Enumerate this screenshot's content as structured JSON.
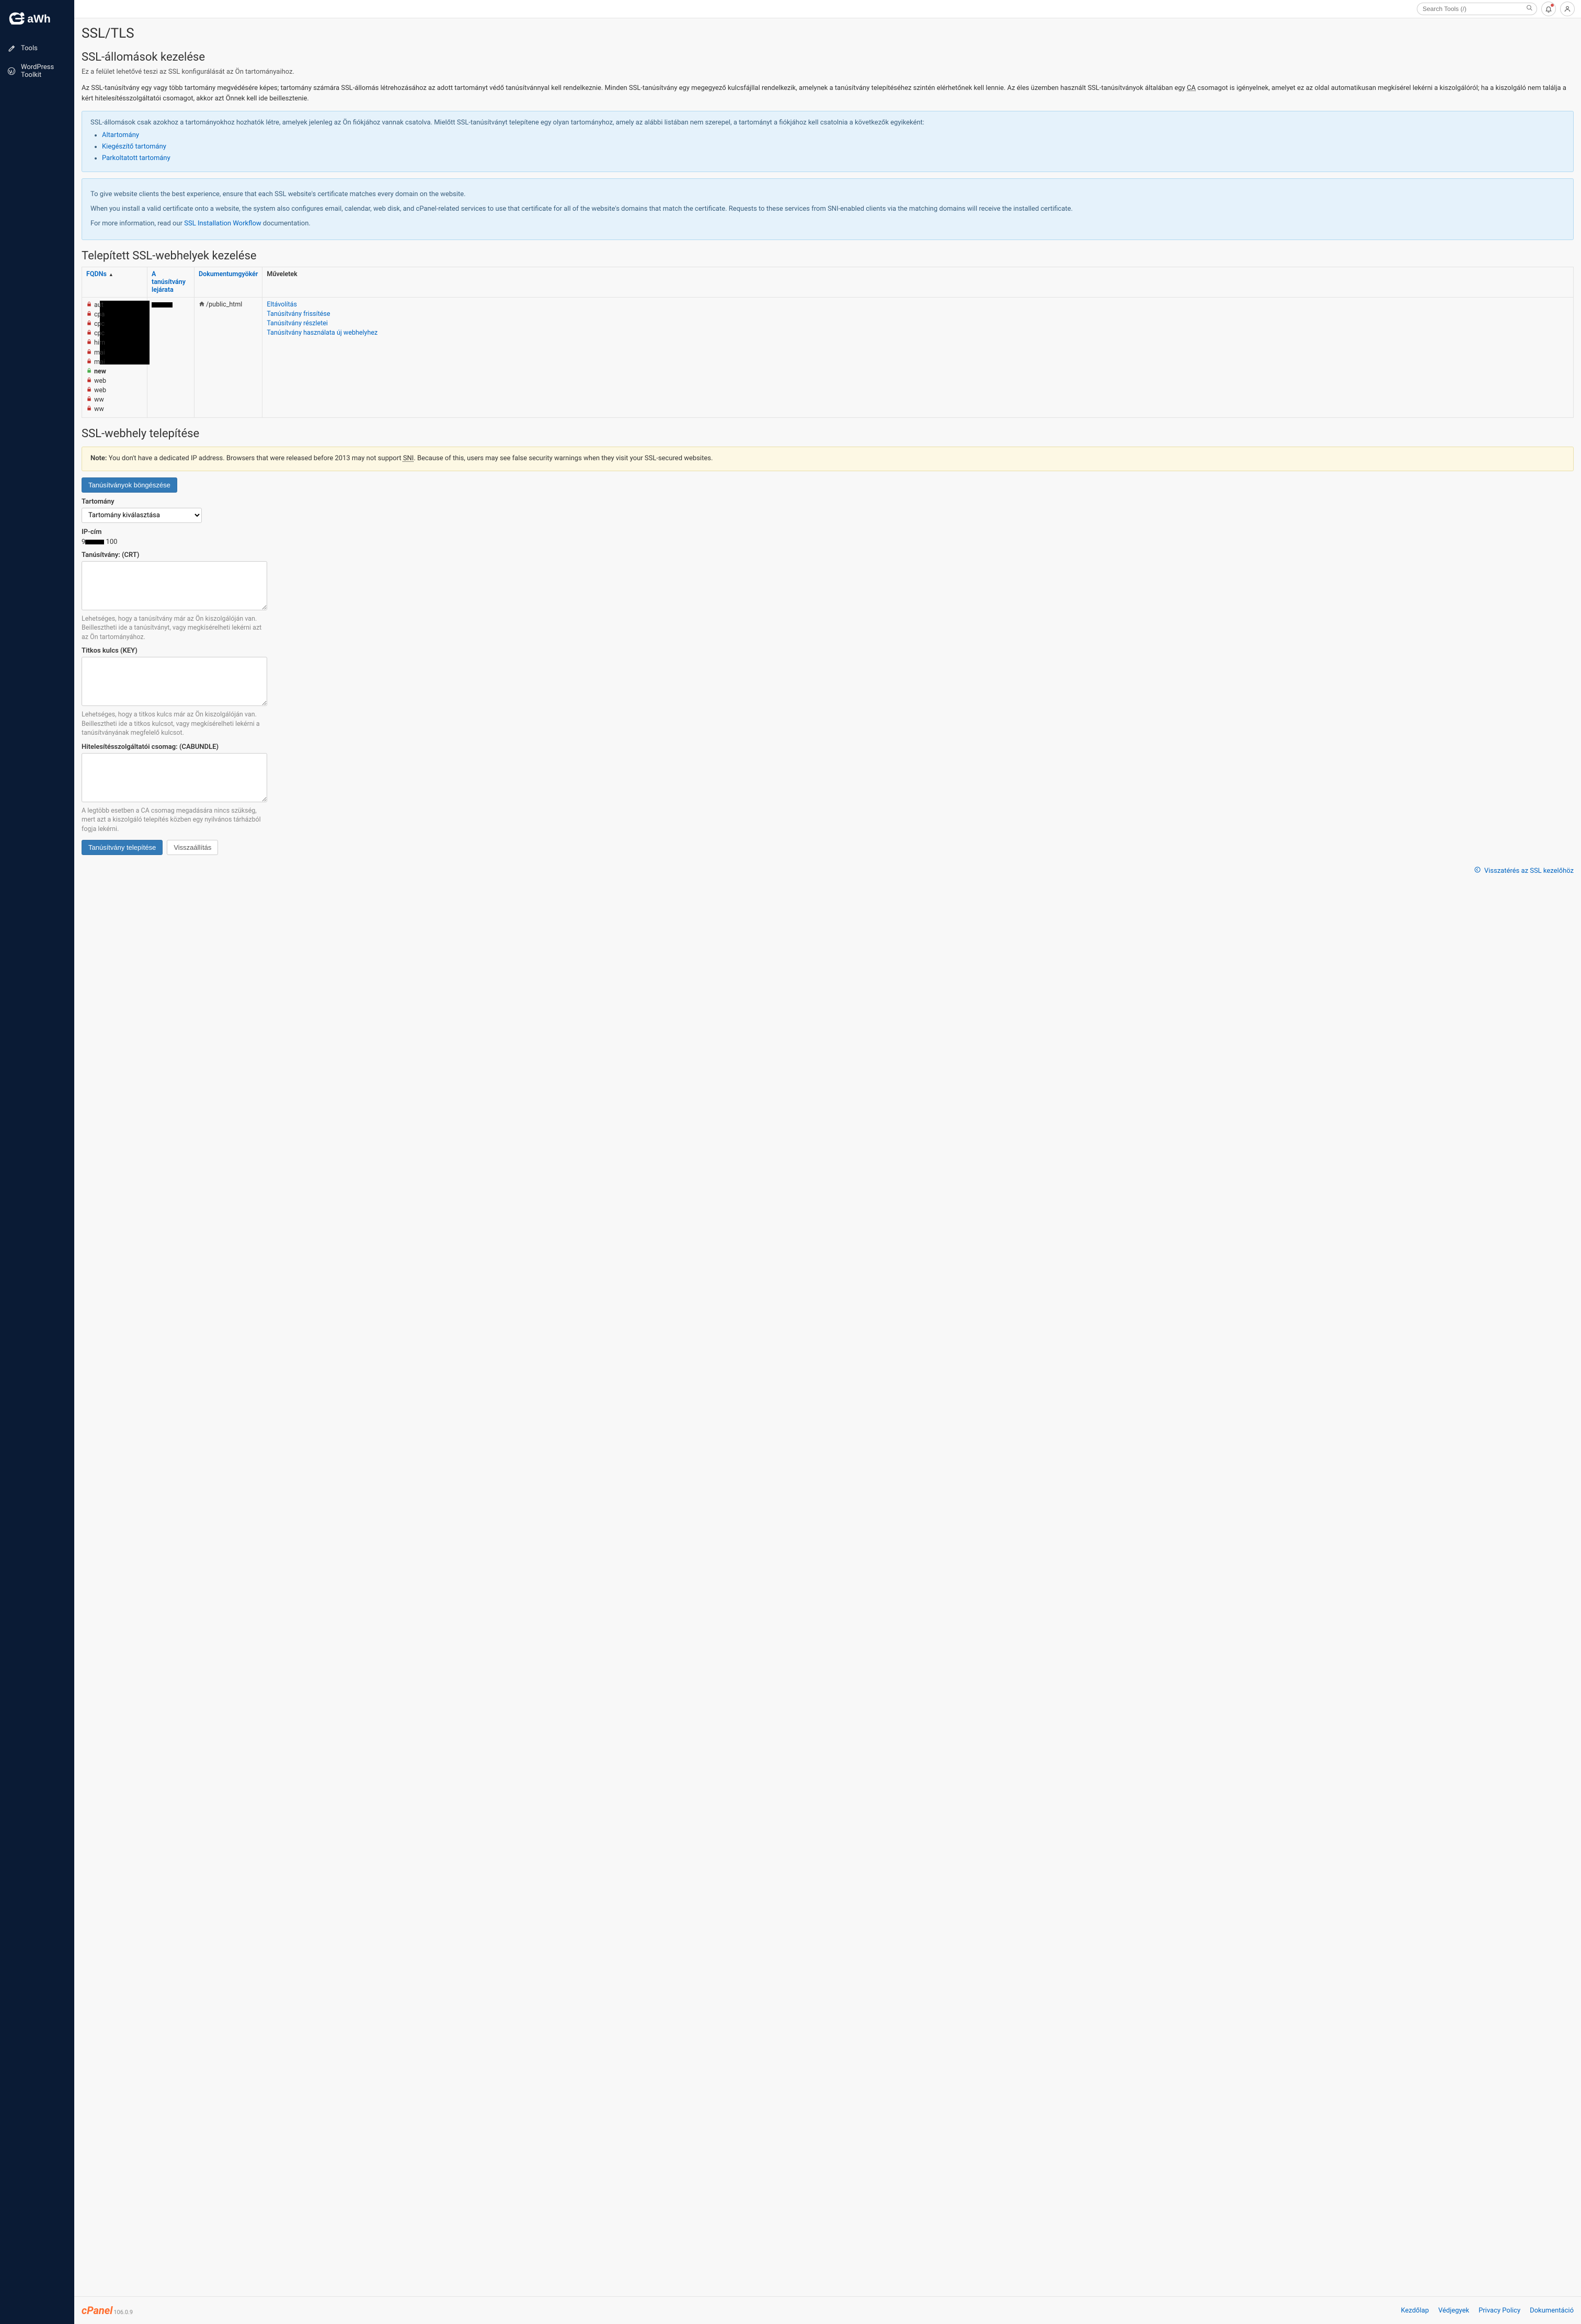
{
  "search": {
    "placeholder": "Search Tools (/)"
  },
  "sidebar": {
    "items": [
      {
        "label": "Tools"
      },
      {
        "label": "WordPress Toolkit"
      }
    ]
  },
  "page": {
    "title": "SSL/TLS",
    "h2_manage": "SSL-állomások kezelése",
    "desc": "Ez a felület lehetővé teszi az SSL konfigurálását az Ön tartományaihoz.",
    "para1_a": "Az SSL-tanúsítvány egy vagy több tartomány megvédésére képes; tartomány számára SSL-állomás létrehozásához az adott tartományt védő tanúsítvánnyal kell rendelkeznie. Minden SSL-tanúsítvány egy megegyező kulcsfájllal rendelkezik, amelynek a tanúsítvány telepítéséhez szintén elérhetőnek kell lennie. Az éles üzemben használt SSL-tanúsítványok általában egy ",
    "para1_abbr": "CA",
    "para1_b": " csomagot is igényelnek, amelyet ez az oldal automatikusan megkísérel lekérni a kiszolgálóról; ha a kiszolgáló nem találja a kért hitelesítésszolgáltatói csomagot, akkor azt Önnek kell ide beillesztenie.",
    "alert1_intro": "SSL-állomások csak azokhoz a tartományokhoz hozhatók létre, amelyek jelenleg az Ön fiókjához vannak csatolva. Mielőtt SSL-tanúsítványt telepítene egy olyan tartományhoz, amely az alábbi listában nem szerepel, a tartományt a fiókjához kell csatolnia a következők egyikeként:",
    "alert1_items": [
      "Altartomány",
      "Kiegészítő tartomány",
      "Parkoltatott tartomány"
    ],
    "alert2_p1": "To give website clients the best experience, ensure that each SSL website's certificate matches every domain on the website.",
    "alert2_p2": "When you install a valid certificate onto a website, the system also configures email, calendar, web disk, and cPanel-related services to use that certificate for all of the website's domains that match the certificate. Requests to these services from SNI-enabled clients via the matching domains will receive the installed certificate.",
    "alert2_p3a": "For more information, read our ",
    "alert2_link": "SSL Installation Workflow",
    "alert2_p3b": " documentation.",
    "h2_installed": "Telepített SSL-webhelyek kezelése"
  },
  "table": {
    "headers": {
      "fqdn": "FQDNs",
      "expiry": "A tanúsítvány lejárata",
      "docroot": "Dokumentumgyökér",
      "actions": "Műveletek"
    },
    "fqdns": [
      {
        "lock": "red",
        "prefix": "aut"
      },
      {
        "lock": "red",
        "prefix": "cpa"
      },
      {
        "lock": "red",
        "prefix": "cpc"
      },
      {
        "lock": "red",
        "prefix": "cpc"
      },
      {
        "lock": "red",
        "prefix": "hirn"
      },
      {
        "lock": "red",
        "prefix": "mai"
      },
      {
        "lock": "red",
        "prefix": "mai"
      },
      {
        "lock": "green",
        "prefix": "new",
        "bold": true
      },
      {
        "lock": "red",
        "prefix": "web"
      },
      {
        "lock": "red",
        "prefix": "web"
      },
      {
        "lock": "red",
        "prefix": "ww"
      },
      {
        "lock": "red",
        "prefix": "ww"
      }
    ],
    "docroot": "/public_html",
    "actions": [
      "Eltávolítás",
      "Tanúsítvány frissítése",
      "Tanúsítvány részletei",
      "Tanúsítvány használata új webhelyhez"
    ]
  },
  "install": {
    "h2": "SSL-webhely telepítése",
    "note_label": "Note:",
    "note_a": " You don't have a dedicated IP address. Browsers that were released before 2013 may not support ",
    "note_abbr": "SNI",
    "note_b": ". Because of this, users may see false security warnings when they visit your SSL-secured websites.",
    "browse_btn": "Tanúsítványok böngészése",
    "domain_label": "Tartomány",
    "domain_placeholder": "Tartomány kiválasztása",
    "ip_label": "IP-cím",
    "ip_prefix": "9",
    "ip_suffix": "100",
    "crt_label": "Tanúsítvány: (CRT)",
    "crt_help": "Lehetséges, hogy a tanúsítvány már az Ön kiszolgálóján van. Beillesztheti ide a tanúsítványt, vagy megkísérelheti lekérni azt az Ön tartományához.",
    "key_label": "Titkos kulcs (KEY)",
    "key_help": "Lehetséges, hogy a titkos kulcs már az Ön kiszolgálóján van. Beillesztheti ide a titkos kulcsot, vagy megkísérelheti lekérni a tanúsítványának megfelelő kulcsot.",
    "cab_label": "Hitelesítésszolgáltatói csomag: (CABUNDLE)",
    "cab_help": "A legtöbb esetben a CA csomag megadására nincs szükség, mert azt a kiszolgáló telepítés közben egy nyilvános tárházból fogja lekérni.",
    "install_btn": "Tanúsítvány telepítése",
    "reset_btn": "Visszaállítás",
    "back_link": "Visszatérés az SSL kezelőhöz"
  },
  "footer": {
    "brand": "cPanel",
    "version": "106.0.9",
    "links": [
      "Kezdőlap",
      "Védjegyek",
      "Privacy Policy",
      "Dokumentáció"
    ]
  }
}
